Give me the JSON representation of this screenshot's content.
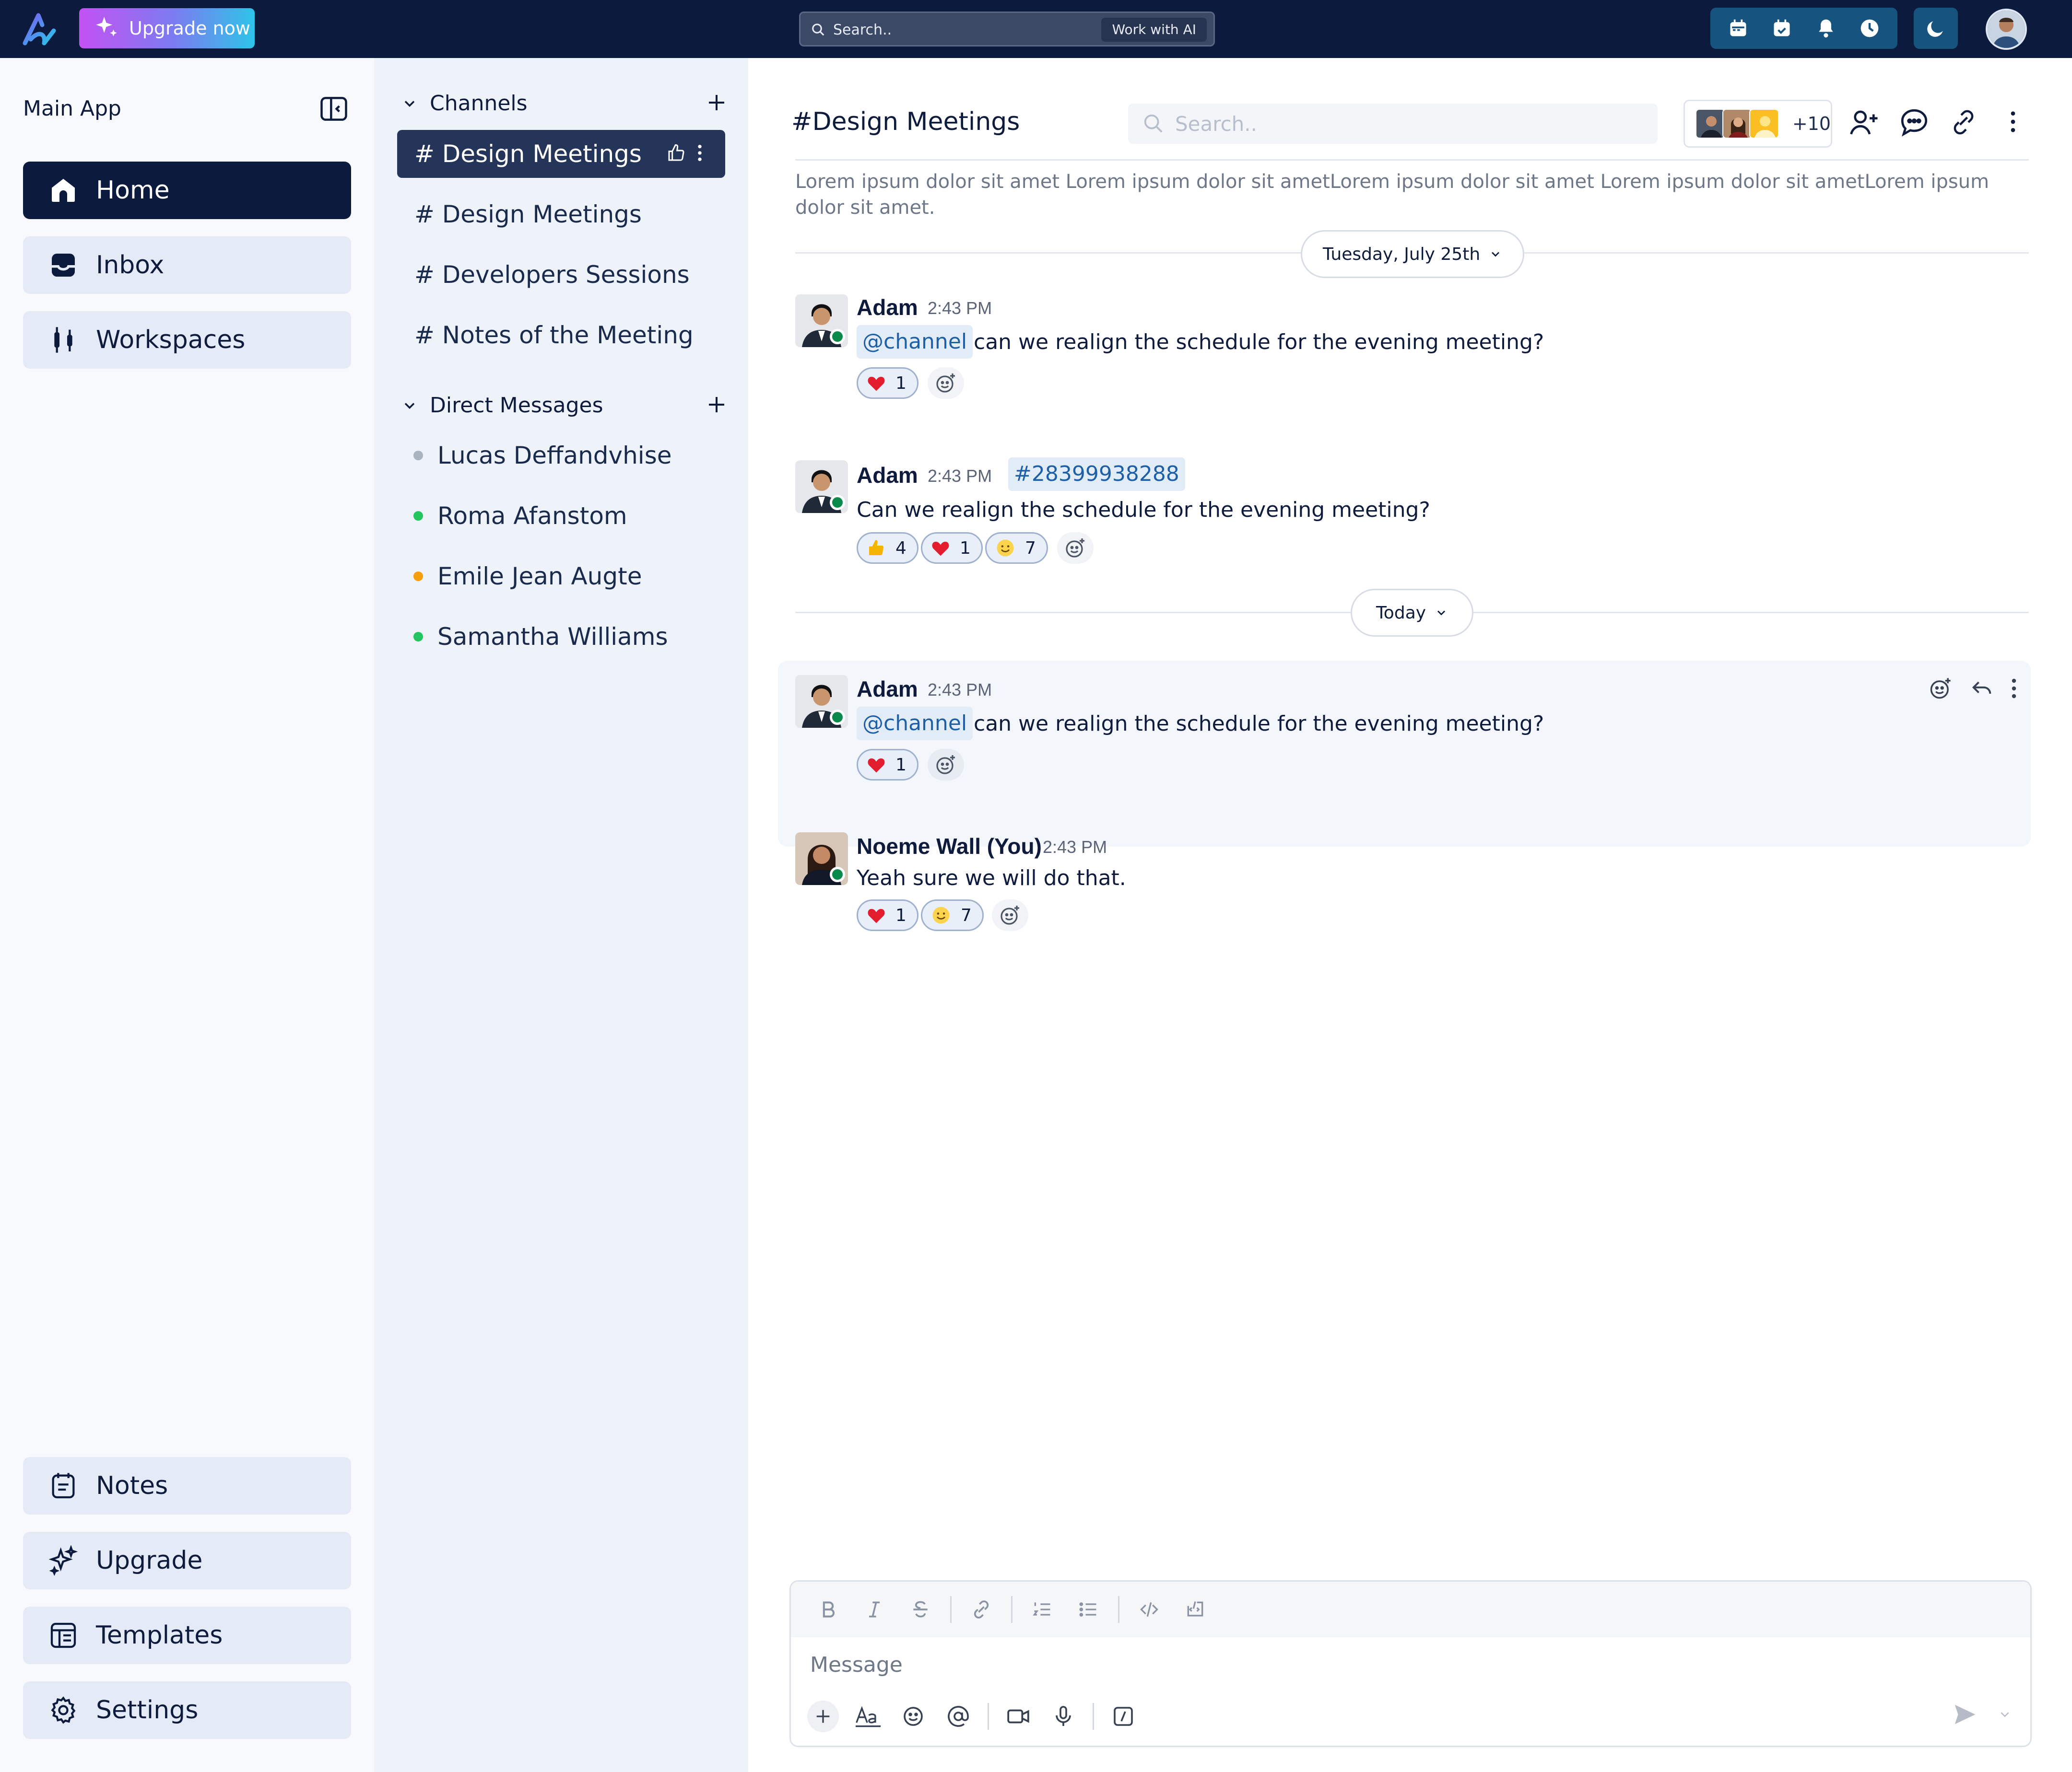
{
  "topbar": {
    "upgrade_label": "Upgrade now",
    "search_placeholder": "Search..",
    "ai_button": "Work with AI",
    "icons": [
      "calendar-icon",
      "calendar-check-icon",
      "bell-icon",
      "clock-icon",
      "moon-icon"
    ]
  },
  "sidebar": {
    "title": "Main App",
    "nav": [
      {
        "label": "Home",
        "icon": "home-icon",
        "active": true
      },
      {
        "label": "Inbox",
        "icon": "inbox-icon"
      },
      {
        "label": "Workspaces",
        "icon": "workspaces-icon"
      }
    ],
    "bottom": [
      {
        "label": "Notes",
        "icon": "notes-icon"
      },
      {
        "label": "Upgrade",
        "icon": "sparkles-icon"
      },
      {
        "label": "Templates",
        "icon": "templates-icon"
      },
      {
        "label": "Settings",
        "icon": "gear-icon"
      }
    ]
  },
  "panel": {
    "channels_title": "Channels",
    "channels": [
      "# Design Meetings",
      "# Design Meetings",
      "# Developers Sessions",
      "# Notes of the Meeting"
    ],
    "dm_title": "Direct Messages",
    "dms": [
      {
        "name": "Lucas Deffandvhise",
        "status_color": "#a9b2bf"
      },
      {
        "name": "Roma Afanstom",
        "status_color": "#22c55e"
      },
      {
        "name": "Emile Jean Augte",
        "status_color": "#f59e0b"
      },
      {
        "name": "Samantha Williams",
        "status_color": "#22c55e"
      }
    ]
  },
  "channel": {
    "title": "#Design Meetings",
    "search_placeholder": "Search..",
    "member_more": "+10",
    "description": "Lorem ipsum dolor sit amet Lorem ipsum dolor sit ametLorem ipsum dolor sit amet Lorem ipsum dolor sit ametLorem ipsum dolor sit amet.",
    "date1": "Tuesday, July 25th",
    "date2": "Today"
  },
  "messages": [
    {
      "user": "Adam",
      "time": "2:43 PM",
      "mention": "@channel",
      "text": "can we realign the schedule for the evening meeting?",
      "reactions": [
        {
          "emoji": "heart",
          "count": "1"
        }
      ]
    },
    {
      "user": "Adam",
      "time": "2:43 PM",
      "tag": "#28399938288",
      "text": "Can we realign the schedule for the evening meeting?",
      "reactions": [
        {
          "emoji": "thumbs-up",
          "count": "4"
        },
        {
          "emoji": "heart",
          "count": "1"
        },
        {
          "emoji": "smile",
          "count": "7"
        }
      ]
    },
    {
      "user": "Adam",
      "time": "2:43 PM",
      "mention": "@channel",
      "text": "can we realign the schedule for the evening meeting?",
      "reactions": [
        {
          "emoji": "heart",
          "count": "1"
        }
      ]
    },
    {
      "user": "Noeme Wall (You)",
      "time": "2:43 PM",
      "text": "Yeah sure we will do that.",
      "reactions": [
        {
          "emoji": "heart",
          "count": "1"
        },
        {
          "emoji": "smile",
          "count": "7"
        }
      ]
    }
  ],
  "composer": {
    "placeholder": "Message",
    "format_tools": [
      "bold",
      "italic",
      "strikethrough",
      "link",
      "ordered-list",
      "bullet-list",
      "code",
      "code-block"
    ],
    "bottom_tools": [
      "plus",
      "text-format",
      "emoji",
      "mention",
      "video",
      "microphone",
      "slash-command"
    ]
  },
  "colors": {
    "navy": "#0c1a3d",
    "accent": "#16537e",
    "mention_bg": "#e2ecf7",
    "mention_text": "#1e5fa5",
    "online": "#0a8a4a"
  }
}
